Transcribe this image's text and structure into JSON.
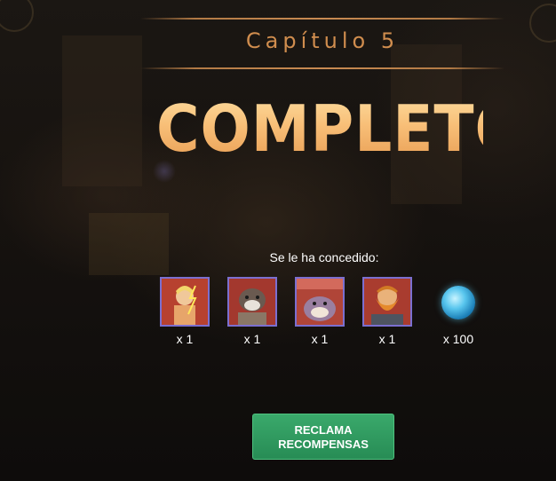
{
  "header": {
    "chapter_title": "Capítulo 5",
    "status_title": "COMPLETO"
  },
  "rewards": {
    "label": "Se le ha concedido:",
    "items": [
      {
        "icon": "hero-card-lightning-icon",
        "quantity": "x 1"
      },
      {
        "icon": "hero-card-beast-icon",
        "quantity": "x 1"
      },
      {
        "icon": "hero-card-ogre-icon",
        "quantity": "x 1"
      },
      {
        "icon": "hero-card-dwarf-icon",
        "quantity": "x 1"
      },
      {
        "icon": "blue-orb-icon",
        "quantity": "x 100"
      }
    ]
  },
  "claim_button": {
    "line1": "RECLAMA",
    "line2": "RECOMPENSAS"
  },
  "colors": {
    "accent_gold": "#d08d4e",
    "button_green": "#2f9a5f",
    "card_border": "#7b6fd0"
  }
}
